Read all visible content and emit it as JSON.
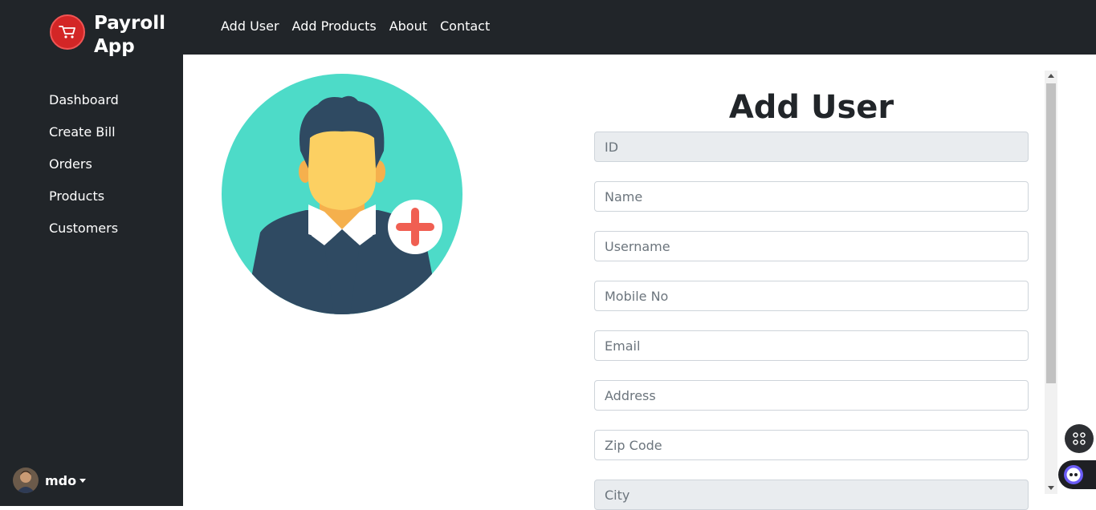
{
  "brand": {
    "name": "Payroll App"
  },
  "sidebar": {
    "items": [
      {
        "label": "Dashboard"
      },
      {
        "label": "Create Bill"
      },
      {
        "label": "Orders"
      },
      {
        "label": "Products"
      },
      {
        "label": "Customers"
      }
    ],
    "user": {
      "name": "mdo"
    }
  },
  "topnav": {
    "items": [
      {
        "label": "Add User"
      },
      {
        "label": "Add Products"
      },
      {
        "label": "About"
      },
      {
        "label": "Contact"
      }
    ]
  },
  "form": {
    "title": "Add User",
    "fields": [
      {
        "placeholder": "ID",
        "disabled": true
      },
      {
        "placeholder": "Name"
      },
      {
        "placeholder": "Username"
      },
      {
        "placeholder": "Mobile No"
      },
      {
        "placeholder": "Email"
      },
      {
        "placeholder": "Address"
      },
      {
        "placeholder": "Zip Code"
      },
      {
        "placeholder": "City",
        "disabled": true
      }
    ]
  },
  "colors": {
    "dark": "#212529",
    "logo_red": "#d32626",
    "illustration_bg": "#4ddbc8",
    "plus_red": "#f05f52"
  },
  "icons": [
    "cart-icon",
    "add-user-illustration",
    "apps-icon",
    "assistant-icon"
  ]
}
